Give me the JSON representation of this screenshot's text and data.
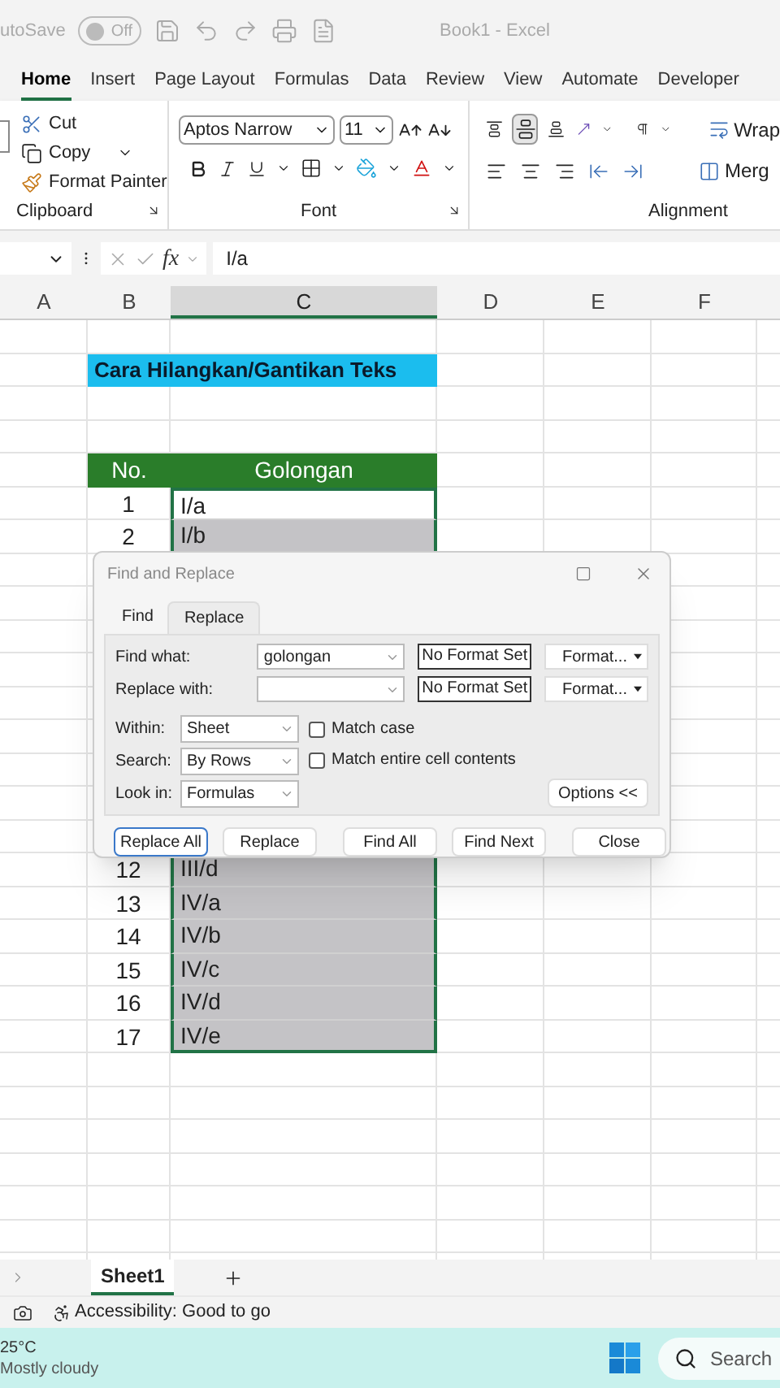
{
  "title_bar": {
    "autosave_label": "utoSave",
    "autosave_on": false,
    "autosave_state": "Off",
    "title": "Book1 - Excel"
  },
  "ribbon_tabs": [
    {
      "label": "Home",
      "selected": true
    },
    {
      "label": "Insert",
      "selected": false
    },
    {
      "label": "Page Layout",
      "selected": false
    },
    {
      "label": "Formulas",
      "selected": false
    },
    {
      "label": "Data",
      "selected": false
    },
    {
      "label": "Review",
      "selected": false
    },
    {
      "label": "View",
      "selected": false
    },
    {
      "label": "Automate",
      "selected": false
    },
    {
      "label": "Developer",
      "selected": false
    }
  ],
  "clipboard": {
    "cut": "Cut",
    "copy": "Copy",
    "format_painter": "Format Painter",
    "group_label": "Clipboard"
  },
  "font": {
    "font_name": "Aptos Narrow",
    "font_size": "11",
    "group_label": "Font"
  },
  "alignment": {
    "wrap": "Wrap",
    "merge": "Merg",
    "group_label": "Alignment"
  },
  "formula_bar": {
    "function_label": "fx",
    "content": "I/a"
  },
  "columns": [
    {
      "label": "A",
      "selected": false
    },
    {
      "label": "B",
      "selected": false
    },
    {
      "label": "C",
      "selected": true
    },
    {
      "label": "D",
      "selected": false
    },
    {
      "label": "E",
      "selected": false
    },
    {
      "label": "F",
      "selected": false
    }
  ],
  "table": {
    "title": "Cara Hilangkan/Gantikan Teks",
    "headers": [
      "No.",
      "Golongan"
    ],
    "rows_top": [
      {
        "no": "1",
        "golongan": "I/a",
        "selected": false
      },
      {
        "no": "2",
        "golongan": "I/b",
        "selected": true
      }
    ],
    "rows_bottom": [
      {
        "no": "12",
        "golongan": "III/d",
        "selected": true
      },
      {
        "no": "13",
        "golongan": "IV/a",
        "selected": true
      },
      {
        "no": "14",
        "golongan": "IV/b",
        "selected": true
      },
      {
        "no": "15",
        "golongan": "IV/c",
        "selected": true
      },
      {
        "no": "16",
        "golongan": "IV/d",
        "selected": true
      },
      {
        "no": "17",
        "golongan": "IV/e",
        "selected": true
      }
    ]
  },
  "dialog": {
    "title": "Find and Replace",
    "tabs": [
      {
        "label": "Find",
        "selected": false
      },
      {
        "label": "Replace",
        "selected": true
      }
    ],
    "fields": [
      {
        "label": "Find what:",
        "value": "golongan",
        "format": "No Format Set",
        "format_button": "Format..."
      },
      {
        "label": "Replace with:",
        "format": "No Format Set",
        "format_button": "Format..."
      }
    ],
    "selects": [
      {
        "label": "Within:",
        "value": "Sheet"
      },
      {
        "label": "Search:",
        "value": "By Rows"
      },
      {
        "label": "Look in:",
        "value": "Formulas"
      }
    ],
    "checkboxes": [
      {
        "label": "Match case",
        "checked": false
      },
      {
        "label": "Match entire cell contents",
        "checked": false
      }
    ],
    "options_button": "Options <<",
    "buttons": [
      {
        "label": "Replace All",
        "default": true
      },
      {
        "label": "Replace",
        "default": false
      },
      {
        "label": "Find All",
        "default": false
      },
      {
        "label": "Find Next",
        "default": false
      },
      {
        "label": "Close",
        "default": false
      }
    ]
  },
  "sheet_tabs": [
    {
      "label": "Sheet1",
      "selected": true
    }
  ],
  "status_bar": {
    "accessibility": "Accessibility: Good to go"
  },
  "taskbar": {
    "temperature": "25°C",
    "weather": "Mostly cloudy",
    "search": "Search"
  }
}
